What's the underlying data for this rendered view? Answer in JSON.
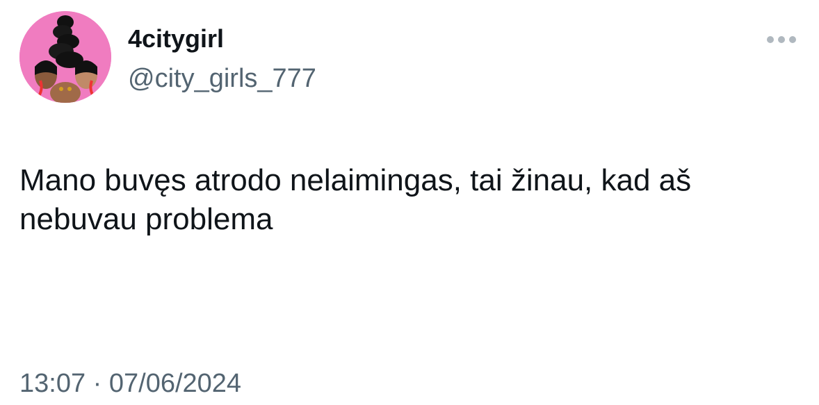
{
  "tweet": {
    "author": {
      "display_name": "4citygirl",
      "handle": "@city_girls_777",
      "avatar_icon": "profile-avatar"
    },
    "more_icon": "more-options-icon",
    "text": "Mano buvęs atrodo nelaimingas, tai žinau, kad aš nebuvau problema",
    "timestamp": "13:07 · 07/06/2024"
  },
  "colors": {
    "background": "#ffffff",
    "primary_text": "#0f1419",
    "secondary_text": "#536471",
    "avatar_bg": "#f07cc0",
    "more_dots": "#b0b8bf"
  }
}
